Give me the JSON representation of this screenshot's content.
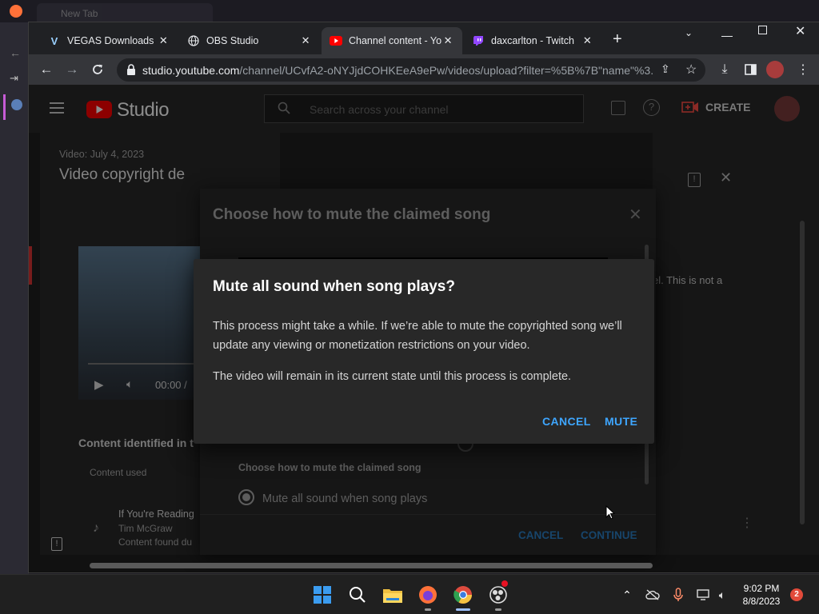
{
  "background_window": {
    "tab_title": "New Tab"
  },
  "browser": {
    "tabs": [
      {
        "label": "VEGAS Downloads | D",
        "favicon": "vegas-icon"
      },
      {
        "label": "OBS Studio",
        "favicon": "globe-icon"
      },
      {
        "label": "Channel content - Yo",
        "favicon": "youtube-icon",
        "active": true
      },
      {
        "label": "daxcarlton - Twitch",
        "favicon": "twitch-icon"
      }
    ],
    "url_host": "studio.youtube.com",
    "url_path": "/channel/UCvfA2-oNYJjdCOHKEeA9ePw/videos/upload?filter=%5B%7B\"name\"%3..."
  },
  "studio": {
    "logo_text": "Studio",
    "search_placeholder": "Search across your channel",
    "create_label": "CREATE",
    "video_date": "Video: July 4, 2023",
    "panel_title": "Video copyright de",
    "player_time": "00:00 /",
    "content_heading": "Content identified in t",
    "content_used_header": "Content used",
    "song_title": "If You're Reading",
    "song_artist": "Tim McGraw",
    "song_found": "Content found du",
    "right_text": "el. This is not a"
  },
  "mute_dialog": {
    "title": "Choose how to mute the claimed song",
    "section_label": "Choose how to mute the claimed song",
    "option_label": "Mute all sound when song plays",
    "cancel_label": "CANCEL",
    "continue_label": "CONTINUE"
  },
  "confirm_dialog": {
    "title": "Mute all sound when song plays?",
    "paragraph1": "This process might take a while. If we’re able to mute the copyrighted song we’ll update any viewing or monetization restrictions on your video.",
    "paragraph2": "The video will remain in its current state until this process is complete.",
    "cancel_label": "CANCEL",
    "mute_label": "MUTE"
  },
  "taskbar": {
    "time": "9:02 PM",
    "date": "8/8/2023",
    "notification_count": "2"
  },
  "colors": {
    "accent_blue": "#3ea6ff",
    "youtube_red": "#ff0000",
    "dialog_bg": "#282828"
  }
}
